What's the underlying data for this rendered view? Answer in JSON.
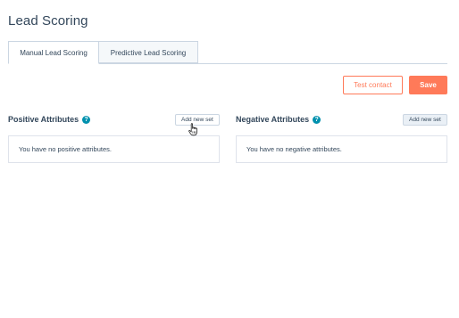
{
  "page": {
    "title": "Lead Scoring"
  },
  "tabs": [
    {
      "label": "Manual Lead Scoring",
      "active": true
    },
    {
      "label": "Predictive Lead Scoring",
      "active": false
    }
  ],
  "actions": {
    "test_contact_label": "Test contact",
    "save_label": "Save"
  },
  "positive": {
    "heading": "Positive Attributes",
    "help_icon": "?",
    "add_label": "Add new set",
    "empty_text": "You have no positive attributes."
  },
  "negative": {
    "heading": "Negative Attributes",
    "help_icon": "?",
    "add_label": "Add new set",
    "empty_text": "You have no negative attributes."
  },
  "colors": {
    "accent": "#ff7a59",
    "help": "#0091ae",
    "text": "#33475b",
    "border": "#cbd6e2"
  },
  "icons": {
    "help": "question-mark-circle-icon",
    "cursor": "hand-pointer-icon"
  }
}
